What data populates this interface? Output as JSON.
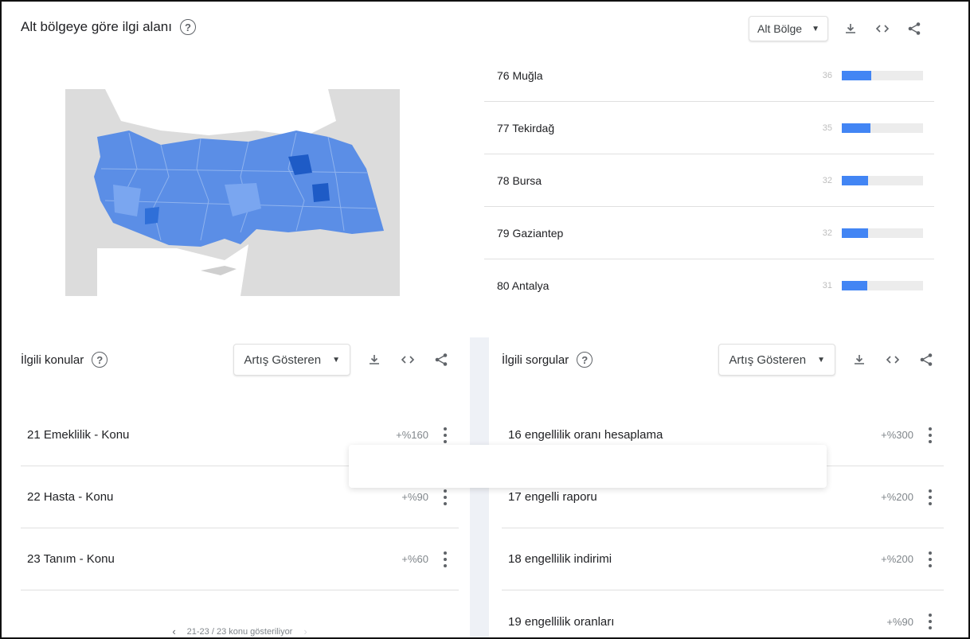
{
  "region_card": {
    "title": "Alt bölgeye göre ilgi alanı",
    "help_icon": "?",
    "resolution_select": "Alt Bölge",
    "regions": [
      {
        "label": "76 Muğla",
        "value": "36",
        "level": 36
      },
      {
        "label": "77 Tekirdağ",
        "value": "35",
        "level": 35
      },
      {
        "label": "78 Bursa",
        "value": "32",
        "level": 32
      },
      {
        "label": "79 Gaziantep",
        "value": "32",
        "level": 32
      },
      {
        "label": "80 Antalya",
        "value": "31",
        "level": 31
      }
    ]
  },
  "related_topics": {
    "title": "İlgili konular",
    "help_icon": "?",
    "filter_select": "Artış Gösteren",
    "rows": [
      {
        "label": "21 Emeklilik - Konu",
        "value": "+%160"
      },
      {
        "label": "22 Hasta - Konu",
        "value": "+%90"
      },
      {
        "label": "23 Tanım - Konu",
        "value": "+%60"
      }
    ],
    "pager": "21-23 / 23 konu gösteriliyor",
    "pager_prev": "‹",
    "pager_next": "›"
  },
  "related_queries": {
    "title": "İlgili sorgular",
    "help_icon": "?",
    "filter_select": "Artış Gösteren",
    "rows": [
      {
        "label": "16 engellilik oranı hesaplama",
        "value": "+%300"
      },
      {
        "label": "17 engelli raporu",
        "value": "+%200"
      },
      {
        "label": "18 engellilik indirimi",
        "value": "+%200"
      },
      {
        "label": "19 engellilik oranları",
        "value": "+%90"
      }
    ]
  },
  "icons": {
    "download": "download-icon",
    "embed": "embed-code-icon",
    "share": "share-icon",
    "dropdown": "dropdown-caret-icon",
    "more": "more-vert-icon",
    "help": "help-circle-icon"
  },
  "colors": {
    "bar": "#4285f4",
    "track": "#ececec",
    "map_land": "#dcdcdc",
    "map_fill": "#5b8ee6",
    "map_fill_light": "#7aa6f0",
    "map_fill_dark": "#1e5bc6"
  }
}
